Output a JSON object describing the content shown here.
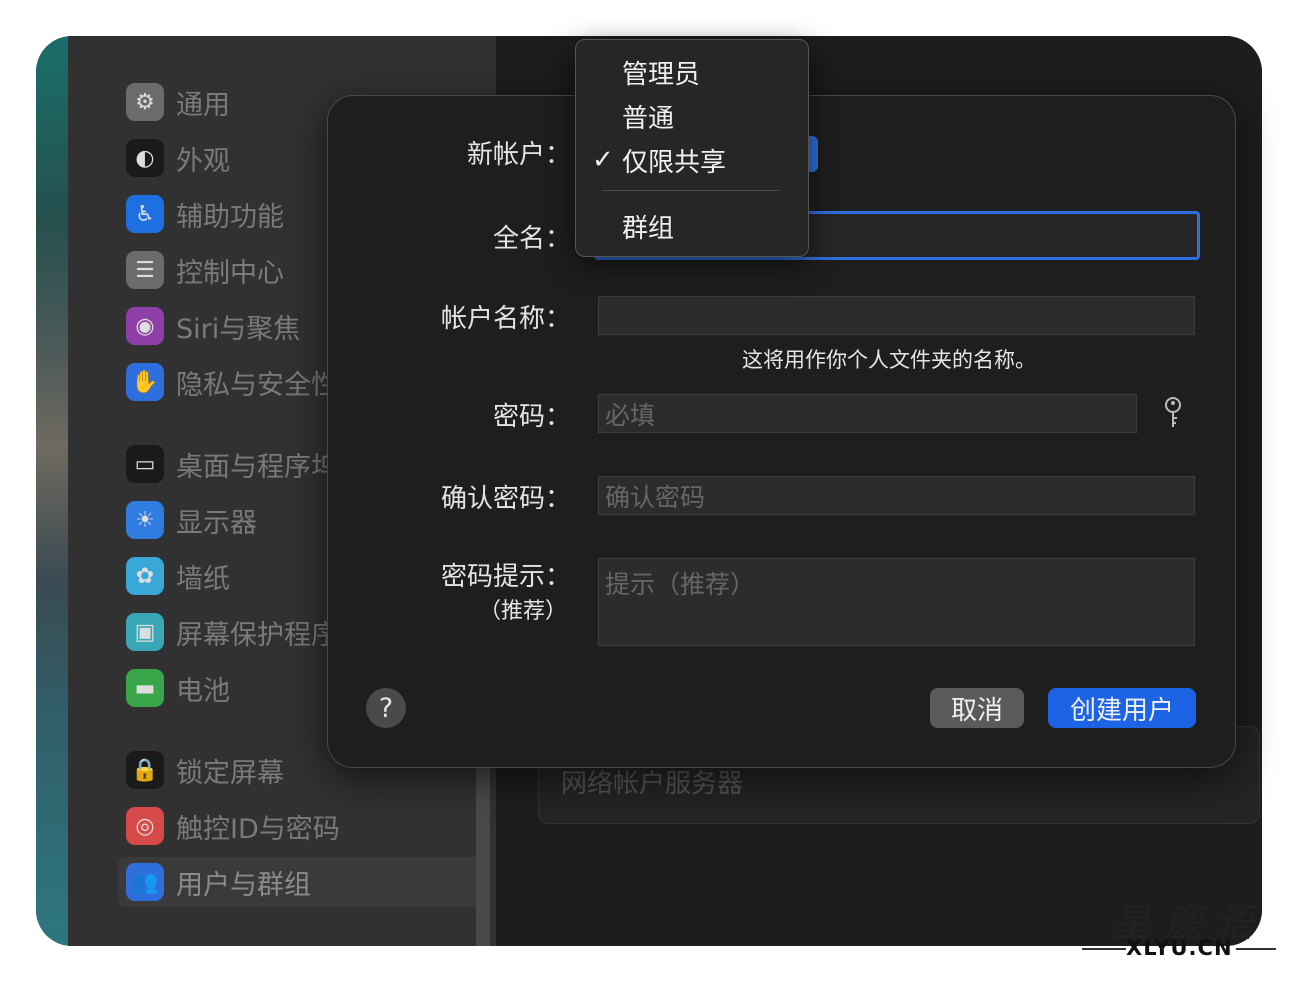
{
  "sidebar": {
    "items": [
      {
        "label": "通用",
        "icon": "gear-icon",
        "color": "#6b6b6b"
      },
      {
        "label": "外观",
        "icon": "appearance-icon",
        "color": "#1a1a1a"
      },
      {
        "label": "辅助功能",
        "icon": "accessibility-icon",
        "color": "#1e6fe0"
      },
      {
        "label": "控制中心",
        "icon": "control-center-icon",
        "color": "#6b6b6b"
      },
      {
        "label": "Siri与聚焦",
        "icon": "siri-icon",
        "color": "#8e3fa8"
      },
      {
        "label": "隐私与安全性",
        "icon": "hand-icon",
        "color": "#2f6fdd"
      },
      {
        "label": "桌面与程序坞",
        "icon": "dock-icon",
        "color": "#1a1a1a"
      },
      {
        "label": "显示器",
        "icon": "brightness-icon",
        "color": "#2f7de0"
      },
      {
        "label": "墙纸",
        "icon": "flower-icon",
        "color": "#39a7d8"
      },
      {
        "label": "屏幕保护程序",
        "icon": "screensaver-icon",
        "color": "#3aa7b8"
      },
      {
        "label": "电池",
        "icon": "battery-icon",
        "color": "#3aa64a"
      },
      {
        "label": "锁定屏幕",
        "icon": "lock-icon",
        "color": "#1a1a1a"
      },
      {
        "label": "触控ID与密码",
        "icon": "fingerprint-icon",
        "color": "#d74a4a"
      },
      {
        "label": "用户与群组",
        "icon": "users-icon",
        "color": "#2f6fdd",
        "selected": true
      }
    ]
  },
  "background": {
    "network_server_label": "网络帐户服务器"
  },
  "dialog": {
    "new_account_label": "新帐户：",
    "fullname_label": "全名：",
    "account_name_label": "帐户名称：",
    "account_name_hint": "这将用作你个人文件夹的名称。",
    "password_label": "密码：",
    "password_placeholder": "必填",
    "confirm_label": "确认密码：",
    "confirm_placeholder": "确认密码",
    "hint_label": "密码提示：",
    "hint_sub_label": "（推荐）",
    "hint_placeholder": "提示（推荐）",
    "help_label": "?",
    "cancel_label": "取消",
    "create_label": "创建用户"
  },
  "account_type_menu": {
    "options": [
      {
        "label": "管理员",
        "checked": false
      },
      {
        "label": "普通",
        "checked": false
      },
      {
        "label": "仅限共享",
        "checked": true
      },
      {
        "label": "群组",
        "checked": false
      }
    ],
    "check_mark": "✓"
  },
  "watermark": {
    "chinese": "星鹿语",
    "domain": "XLYU.CN"
  }
}
